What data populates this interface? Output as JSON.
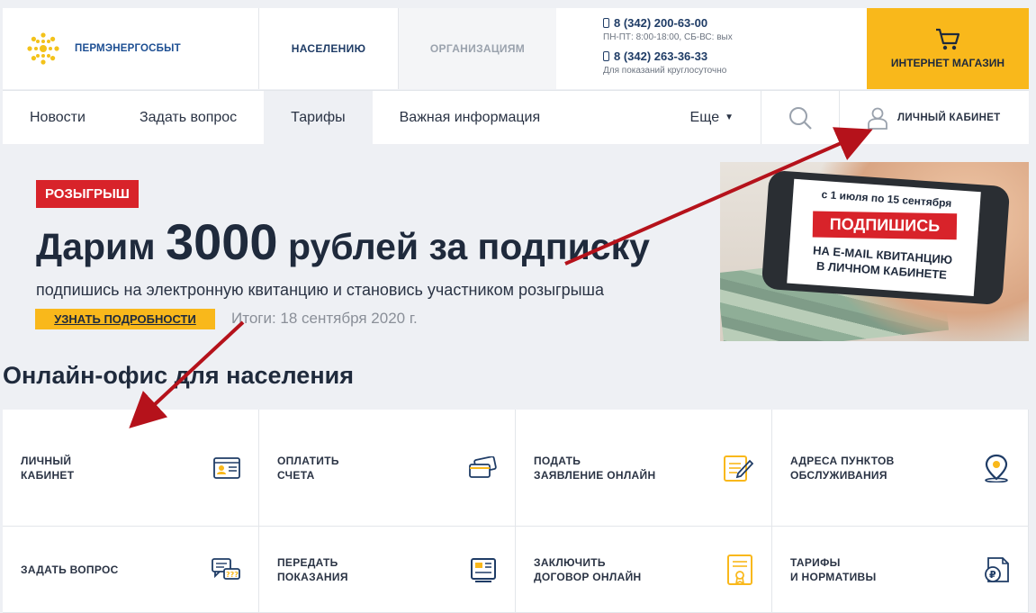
{
  "header": {
    "brand": "ПЕРМЭНЕРГОСБЫТ",
    "segments": [
      "НАСЕЛЕНИЮ",
      "ОРГАНИЗАЦИЯМ"
    ],
    "phone1": "8 (342) 200-63-00",
    "phone1_hours": "ПН-ПТ: 8:00-18:00, СБ-ВС: вых",
    "phone2": "8 (342) 263-36-33",
    "phone2_hours": "Для показаний круглосуточно",
    "shop_label": "ИНТЕРНЕТ МАГАЗИН"
  },
  "nav": {
    "items": [
      "Новости",
      "Задать вопрос",
      "Тарифы",
      "Важная информация"
    ],
    "more_label": "Еще",
    "cabinet_label": "ЛИЧНЫЙ КАБИНЕТ"
  },
  "banner": {
    "badge": "РОЗЫГРЫШ",
    "headline_pre": "Дарим",
    "headline_num": "3000",
    "headline_post": "рублей за подписку",
    "subline": "подпишись на электронную квитанцию и становись участником розыгрыша",
    "button_label": "УЗНАТЬ ПОДРОБНОСТИ",
    "results": "Итоги: 18 сентября 2020 г.",
    "promo_dates": "с 1 июля по 15 сентября",
    "promo_button": "ПОДПИШИСЬ",
    "promo_text1": "НА E-MAIL КВИТАНЦИЮ",
    "promo_text2": "В ЛИЧНОМ КАБИНЕТЕ"
  },
  "online_office": {
    "title": "Онлайн-офис для населения",
    "tiles": [
      {
        "line1": "ЛИЧНЫЙ",
        "line2": "КАБИНЕТ",
        "icon": "id-card-icon"
      },
      {
        "line1": "ОПЛАТИТЬ",
        "line2": "СЧЕТА",
        "icon": "credit-card-icon"
      },
      {
        "line1": "ПОДАТЬ",
        "line2": "ЗАЯВЛЕНИЕ ОНЛАЙН",
        "icon": "edit-document-icon"
      },
      {
        "line1": "АДРЕСА ПУНКТОВ",
        "line2": "ОБСЛУЖИВАНИЯ",
        "icon": "map-pin-icon"
      },
      {
        "line1": "ЗАДАТЬ ВОПРОС",
        "line2": "",
        "icon": "chat-bubbles-icon"
      },
      {
        "line1": "ПЕРЕДАТЬ",
        "line2": "ПОКАЗАНИЯ",
        "icon": "meter-icon"
      },
      {
        "line1": "ЗАКЛЮЧИТЬ",
        "line2": "ДОГОВОР ОНЛАЙН",
        "icon": "contract-icon"
      },
      {
        "line1": "ТАРИФЫ",
        "line2": "И НОРМАТИВЫ",
        "icon": "ruble-document-icon"
      }
    ]
  },
  "colors": {
    "accent": "#f9b81b",
    "brand": "#1d4f93",
    "alert": "#d8232a",
    "arrow": "#b5121b"
  }
}
